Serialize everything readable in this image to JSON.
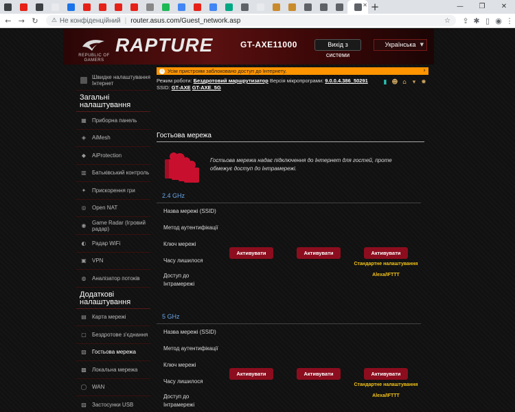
{
  "browser": {
    "tabs": [
      {
        "color": "#3c4043"
      },
      {
        "color": "#e62117"
      },
      {
        "color": "#3c4043"
      },
      {
        "color": "#e8eaed"
      },
      {
        "color": "#1a73e8"
      },
      {
        "color": "#e62117"
      },
      {
        "color": "#e62117"
      },
      {
        "color": "#e62117"
      },
      {
        "color": "#e62117"
      },
      {
        "color": "#888888"
      },
      {
        "color": "#1db954"
      },
      {
        "color": "#4285f4"
      },
      {
        "color": "#e62117"
      },
      {
        "color": "#4285f4"
      },
      {
        "color": "#00a884"
      },
      {
        "color": "#5f6368"
      },
      {
        "color": "#e8eaed"
      },
      {
        "color": "#c98b2c"
      },
      {
        "color": "#c98b2c"
      },
      {
        "color": "#5f6368"
      },
      {
        "color": "#5f6368"
      },
      {
        "color": "#5f6368"
      }
    ],
    "new_tab_label": "+",
    "security_label": "Не конфіденційний",
    "url": "router.asus.com/Guest_network.asp"
  },
  "header": {
    "brand_line1": "REPUBLIC OF",
    "brand_line2": "GAMERS",
    "product": "RAPTURE",
    "model": "GT-AXE11000",
    "logout_label": "Вихід з системи",
    "language": "Українська"
  },
  "sidebar": {
    "quick_setup": "Швидке налаштування Інтернет",
    "general_heading": "Загальні налаштування",
    "general_items": [
      {
        "label": "Приборна панель",
        "icon": "dashboard-icon",
        "glyph": "▦"
      },
      {
        "label": "AiMesh",
        "icon": "mesh-icon",
        "glyph": "◈"
      },
      {
        "label": "AiProtection",
        "icon": "shield-icon",
        "glyph": "◆"
      },
      {
        "label": "Батьківський контроль",
        "icon": "parental-icon",
        "glyph": "▥"
      },
      {
        "label": "Прискорення гри",
        "icon": "rocket-icon",
        "glyph": "✦"
      },
      {
        "label": "Open NAT",
        "icon": "nat-icon",
        "glyph": "◎"
      },
      {
        "label": "Game Radar (Ігровий радар)",
        "icon": "game-radar-icon",
        "glyph": "◉"
      },
      {
        "label": "Радар WiFi",
        "icon": "wifi-radar-icon",
        "glyph": "◐"
      },
      {
        "label": "VPN",
        "icon": "vpn-icon",
        "glyph": "▣"
      },
      {
        "label": "Аналізатор потоків",
        "icon": "traffic-icon",
        "glyph": "◍"
      }
    ],
    "advanced_heading": "Додаткові налаштування",
    "advanced_items": [
      {
        "label": "Карта мережі",
        "icon": "network-map-icon",
        "glyph": "▤"
      },
      {
        "label": "Бездротове з'єднання",
        "icon": "wireless-icon",
        "glyph": "▢"
      },
      {
        "label": "Гостьова мережа",
        "icon": "guest-network-icon",
        "glyph": "▧",
        "active": true
      },
      {
        "label": "Локальна мережа",
        "icon": "lan-icon",
        "glyph": "▩"
      },
      {
        "label": "WAN",
        "icon": "wan-icon",
        "glyph": "◯"
      },
      {
        "label": "Застосунки USB",
        "icon": "usb-icon",
        "glyph": "▨"
      }
    ]
  },
  "main": {
    "notice": "Усім пристроям заблоковано доступ до Інтернету.",
    "mode_label": "Режим роботи:",
    "mode_value": "Бездротовий маршрутизатор",
    "firmware_label": "Версія мікропрограми:",
    "firmware_value": "9.0.0.4.386_50291",
    "ssid_label": "SSID:",
    "ssid_1": "GT-AXE",
    "ssid_2": "GT-AXE_5G",
    "page_title": "Гостьова мережа",
    "description": "Гостьова мережа надає підключення до Інтернет для гостей, проте обмежує доступ до Інтрамережі.",
    "bands": [
      {
        "name": "2.4 GHz",
        "rows": [
          "Назва мережі (SSID)",
          "Метод аутентифікації",
          "Ключ мережі",
          "Часу лишилося",
          "Доступ до Інтрамережі"
        ],
        "activate_labels": [
          "Активувати",
          "Активувати",
          "Активувати"
        ],
        "extra_1": "Стандартне налаштування",
        "extra_2": "Alexa/IFTTT"
      },
      {
        "name": "5 GHz",
        "rows": [
          "Назва мережі (SSID)",
          "Метод аутентифікації",
          "Ключ мережі",
          "Часу лишилося",
          "Доступ до Інтрамережі"
        ],
        "activate_labels": [
          "Активувати",
          "Активувати",
          "Активувати"
        ],
        "extra_1": "Стандартне налаштування",
        "extra_2": "Alexa/IFTTT"
      }
    ]
  },
  "colors": {
    "accent_red": "#8c0d1e",
    "notice_orange": "#ff9400",
    "band_blue": "#6aa7e8",
    "highlight_yellow": "#f5c518"
  }
}
